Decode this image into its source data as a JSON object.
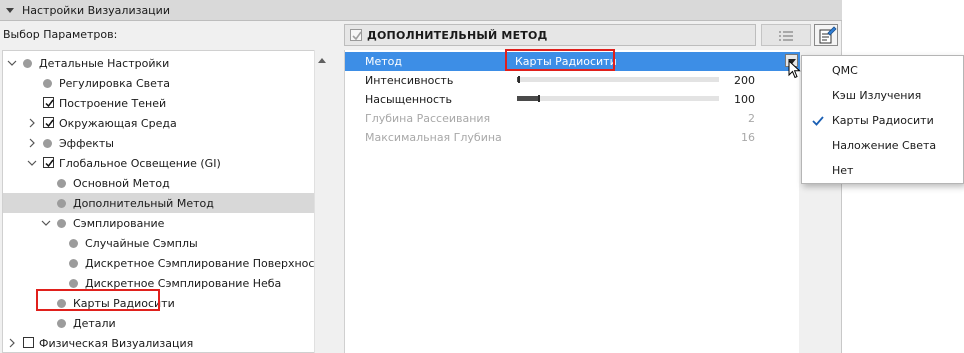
{
  "panel": {
    "title": "Настройки Визуализации"
  },
  "params_label": "Выбор Параметров:",
  "tree": {
    "items": [
      {
        "label": "Детальные Настройки",
        "indent": 0,
        "expander": "down",
        "marker": "dot",
        "selected": false
      },
      {
        "label": "Регулировка Света",
        "indent": 1,
        "expander": "none",
        "marker": "dot",
        "selected": false
      },
      {
        "label": "Построение Теней",
        "indent": 1,
        "expander": "none",
        "marker": "checked",
        "selected": false
      },
      {
        "label": "Окружающая Среда",
        "indent": 1,
        "expander": "right",
        "marker": "checked",
        "selected": false
      },
      {
        "label": "Эффекты",
        "indent": 1,
        "expander": "right",
        "marker": "dot",
        "selected": false
      },
      {
        "label": "Глобальное Освещение (GI)",
        "indent": 1,
        "expander": "down",
        "marker": "checked",
        "selected": false
      },
      {
        "label": "Основной Метод",
        "indent": 2,
        "expander": "none",
        "marker": "dot",
        "selected": false
      },
      {
        "label": "Дополнительный Метод",
        "indent": 2,
        "expander": "none",
        "marker": "dot",
        "selected": true
      },
      {
        "label": "Сэмплирование",
        "indent": 2,
        "expander": "down",
        "marker": "dot",
        "selected": false
      },
      {
        "label": "Случайные Сэмплы",
        "indent": 3,
        "expander": "none",
        "marker": "dot",
        "selected": false
      },
      {
        "label": "Дискретное Сэмплирование Поверхностей",
        "indent": 3,
        "expander": "none",
        "marker": "dot",
        "selected": false
      },
      {
        "label": "Дискретное Сэмплирование Неба",
        "indent": 3,
        "expander": "none",
        "marker": "dot",
        "selected": false
      },
      {
        "label": "Карты Радиосити",
        "indent": 2,
        "expander": "none",
        "marker": "dot",
        "selected": false
      },
      {
        "label": "Детали",
        "indent": 2,
        "expander": "none",
        "marker": "dot",
        "selected": false
      },
      {
        "label": "Физическая Визуализация",
        "indent": 0,
        "expander": "right",
        "marker": "unchecked",
        "selected": false
      }
    ]
  },
  "method_header": {
    "title": "ДОПОЛНИТЕЛЬНЫЙ МЕТОД"
  },
  "properties": [
    {
      "name": "Метод",
      "value": "Карты Радиосити",
      "kind": "dropdown",
      "highlight": true,
      "disabled": false
    },
    {
      "name": "Интенсивность",
      "value": "200",
      "kind": "slider",
      "level": 0.01,
      "highlight": false,
      "disabled": false
    },
    {
      "name": "Насыщенность",
      "value": "100",
      "kind": "slider",
      "level": 0.11,
      "highlight": false,
      "disabled": false
    },
    {
      "name": "Глубина Рассеивания",
      "value": "2",
      "kind": "number",
      "highlight": false,
      "disabled": true
    },
    {
      "name": "Максимальная Глубина",
      "value": "16",
      "kind": "number",
      "highlight": false,
      "disabled": true
    }
  ],
  "dropdown": {
    "options": [
      {
        "label": "QMC",
        "checked": false
      },
      {
        "label": "Кэш Излучения",
        "checked": false
      },
      {
        "label": "Карты Радиосити",
        "checked": true
      },
      {
        "label": "Наложение Света",
        "checked": false
      },
      {
        "label": "Нет",
        "checked": false
      }
    ]
  },
  "colors": {
    "highlight": "#3d8ee6",
    "annotation_red": "#e0201c",
    "selected_row": "#d8d8d8"
  }
}
